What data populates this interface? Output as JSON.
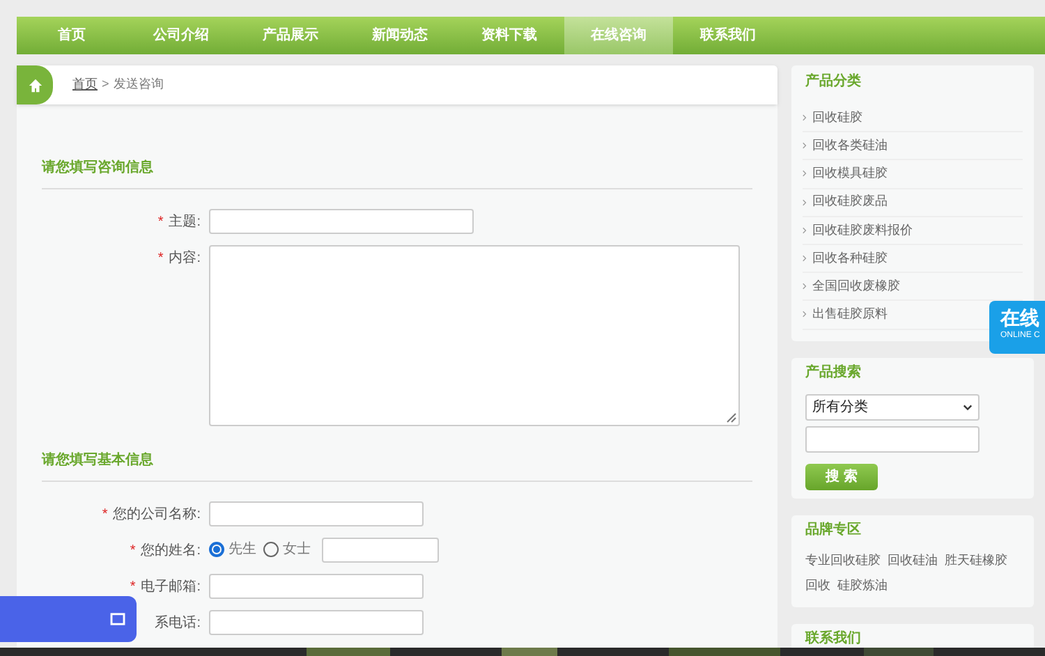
{
  "nav": [
    {
      "label": "首页",
      "selected": false
    },
    {
      "label": "公司介绍",
      "selected": false
    },
    {
      "label": "产品展示",
      "selected": false
    },
    {
      "label": "新闻动态",
      "selected": false
    },
    {
      "label": "资料下载",
      "selected": false
    },
    {
      "label": "在线咨询",
      "selected": true
    },
    {
      "label": "联系我们",
      "selected": false
    }
  ],
  "breadcrumb": {
    "home": "首页",
    "separator": ">",
    "current": "发送咨询"
  },
  "sections": [
    {
      "title": "请您填写咨询信息",
      "fields": [
        {
          "kind": "text",
          "label": "主题:",
          "marker": "*"
        },
        {
          "kind": "textarea",
          "label": "内容:",
          "marker": "*"
        }
      ]
    },
    {
      "title": "请您填写基本信息",
      "fields": [
        {
          "kind": "text",
          "label": "您的公司名称:",
          "marker": "*"
        },
        {
          "kind": "name",
          "label": "您的姓名:",
          "marker": "*",
          "options": [
            {
              "label": "先生",
              "selected": true
            },
            {
              "label": "女士",
              "selected": false
            }
          ]
        },
        {
          "kind": "text",
          "label": "电子邮箱:",
          "marker": "*"
        },
        {
          "kind": "text",
          "label": "系电话:"
        }
      ]
    }
  ],
  "sidebar": {
    "categories": {
      "title": "产品分类",
      "items": [
        "回收硅胶",
        "回收各类硅油",
        "回收模具硅胶",
        "回收硅胶废品",
        "回收硅胶废料报价",
        "回收各种硅胶",
        "全国回收废橡胶",
        "出售硅胶原料"
      ]
    },
    "search": {
      "title": "产品搜索",
      "select": "所有分类",
      "button": "搜 索"
    },
    "brands": {
      "title": "品牌专区",
      "tags": [
        "专业回收硅胶",
        "回收硅油",
        "胜天硅橡胶",
        "回收",
        "硅胶炼油"
      ]
    },
    "contact": {
      "title": "联系我们"
    }
  },
  "online_tab": {
    "title": "在线",
    "subtitle": "ONLINE C"
  }
}
